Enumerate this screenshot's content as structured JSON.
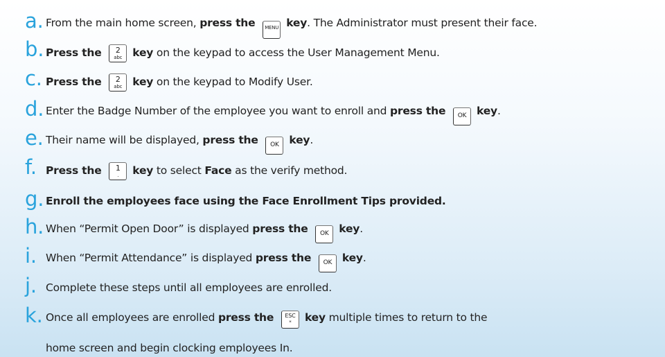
{
  "steps": [
    {
      "letter": "a.",
      "pre": "From the main home screen, ",
      "b1": "press the",
      "key": {
        "top": "MENU",
        "sub": ""
      },
      "b2": "key",
      "post": ". The Administrator must present their face."
    },
    {
      "letter": "b.",
      "pre": "",
      "b1": "Press the",
      "key": {
        "top": "2",
        "sub": "abc"
      },
      "b2": "key",
      "post": " on the keypad to access the User Management Menu."
    },
    {
      "letter": "c.",
      "pre": "",
      "b1": "Press the",
      "key": {
        "top": "2",
        "sub": "abc"
      },
      "b2": "key",
      "post": " on the keypad to Modify User."
    },
    {
      "letter": "d.",
      "pre": "Enter the Badge Number of the employee you want to enroll and ",
      "b1": "press the",
      "key": {
        "top": "OK",
        "sub": ""
      },
      "b2": "key",
      "post": "."
    },
    {
      "letter": "e.",
      "pre": "Their name will be displayed, ",
      "b1": "press the",
      "key": {
        "top": "OK",
        "sub": ""
      },
      "b2": "key",
      "post": "."
    },
    {
      "letter": "f.",
      "pre": "",
      "b1": "Press the",
      "key": {
        "top": "1",
        "sub": "."
      },
      "b2": "key",
      "post": " to select ",
      "b3": "Face",
      "post2": " as the verify method."
    },
    {
      "letter": "g.",
      "bold_full": "Enroll the employees face using the Face Enrollment Tips provided."
    },
    {
      "letter": "h.",
      "pre": "When “Permit Open Door” is displayed ",
      "b1": "press the",
      "key": {
        "top": "OK",
        "sub": ""
      },
      "b2": "key",
      "post": "."
    },
    {
      "letter": "i.",
      "pre": "When “Permit Attendance” is displayed ",
      "b1": "press the",
      "key": {
        "top": "OK",
        "sub": ""
      },
      "b2": "key",
      "post": "."
    },
    {
      "letter": "j.",
      "plain": "Complete these steps until all employees are enrolled."
    },
    {
      "letter": "k.",
      "pre": "Once all employees are enrolled ",
      "b1": "press the",
      "key": {
        "top": "ESC",
        "sub": "*"
      },
      "b2": "key",
      "post": " multiple times to return to the",
      "continuation": "home screen and begin clocking employees In."
    }
  ]
}
